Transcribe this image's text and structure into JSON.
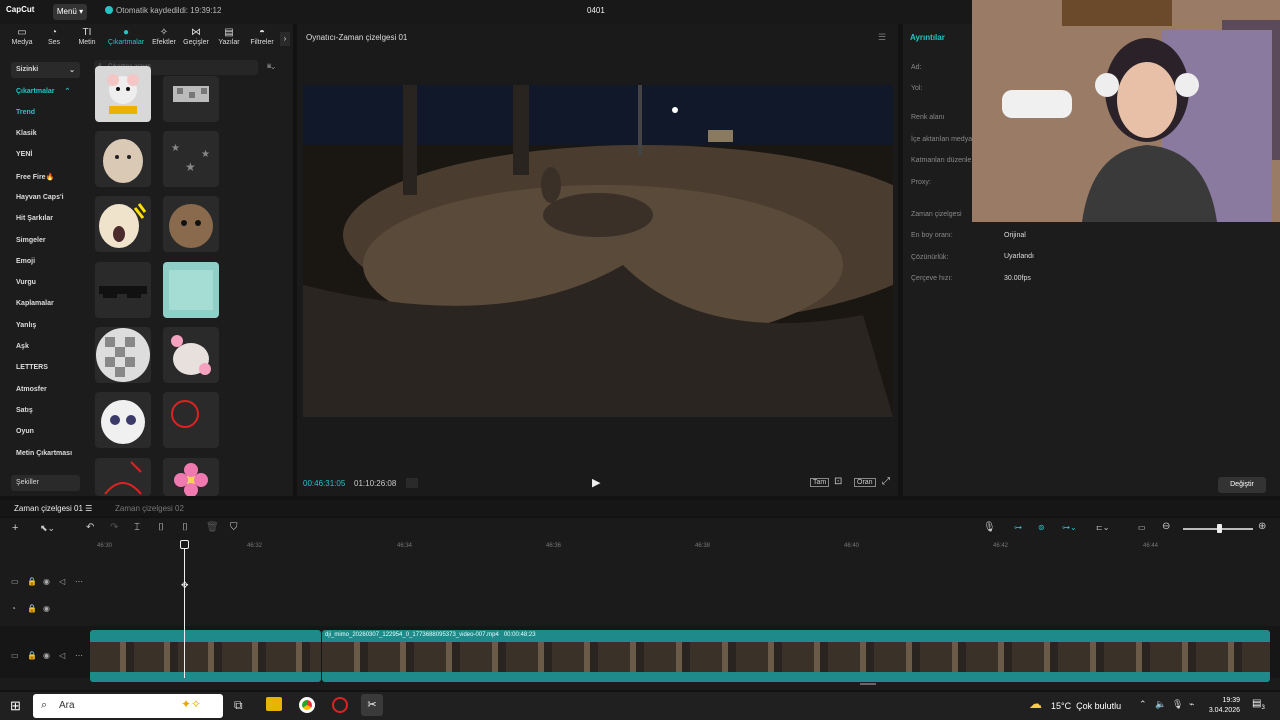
{
  "app": {
    "logo": "CapCut",
    "menu_label": "Menü",
    "autosave": "Otomatik kaydedildi: 19:39:12",
    "project_name": "0401"
  },
  "toolbar": {
    "items": [
      {
        "label": "Medya",
        "icon": "media-icon"
      },
      {
        "label": "Ses",
        "icon": "audio-icon"
      },
      {
        "label": "Metin",
        "icon": "text-icon"
      },
      {
        "label": "Çıkartmalar",
        "icon": "sticker-icon",
        "active": true
      },
      {
        "label": "Efektler",
        "icon": "effects-icon"
      },
      {
        "label": "Geçişler",
        "icon": "transitions-icon"
      },
      {
        "label": "Yazılar",
        "icon": "captions-icon"
      },
      {
        "label": "Filtreler",
        "icon": "filters-icon"
      }
    ]
  },
  "sidebar": {
    "dropdown": "Sizinki",
    "section": "Çıkartmalar",
    "items": [
      "Trend",
      "Klasik",
      "YENİ",
      "Free Fire🔥",
      "Hayvan Caps'i",
      "Hit Şarkılar",
      "Simgeler",
      "Emoji",
      "Vurgu",
      "Kaplamalar",
      "Yanlış",
      "Aşk",
      "LETTERS",
      "Atmosfer",
      "Satış",
      "Oyun",
      "Metin Çıkartması"
    ],
    "bottom": "Şekiller"
  },
  "stickers": {
    "search_placeholder": "Çıkartma arayın"
  },
  "player": {
    "title": "Oynatıcı-Zaman çizelgesi 01",
    "current_time": "00:46:31:05",
    "total_time": "01:10:26:08",
    "ratio_button": "Oran"
  },
  "details": {
    "title": "Ayrıntılar",
    "labels": [
      "Ad:",
      "Yol:",
      "Renk alanı",
      "İçe aktarılan medya",
      "Katmanları düzenle",
      "Proxy:",
      "Zaman çizelgesi",
      "En boy oranı:",
      "Çözünürlük:",
      "Çerçeve hızı:"
    ],
    "aspect_ratio": "Orijinal",
    "resolution": "Uyarlandı",
    "frame_rate": "30.00fps",
    "change_button": "Değiştir"
  },
  "timeline": {
    "tabs": [
      "Zaman çizelgesi 01",
      "Zaman çizelgesi 02"
    ],
    "ticks": [
      "46:30",
      "46:32",
      "46:34",
      "46:36",
      "46:38",
      "46:40",
      "46:42",
      "46:44"
    ],
    "clip_name": "dji_mimo_20260307_122954_0_1773688095373_video-007.mp4",
    "clip_duration": "00:00:48:23"
  },
  "taskbar": {
    "search": "Ara",
    "weather": "15°C  Çok bulutlu",
    "time": "19:39",
    "date": "3.04.2026",
    "notif_count": "3"
  },
  "colors": {
    "accent": "#25c4c6",
    "clip": "#1f8a8a"
  }
}
